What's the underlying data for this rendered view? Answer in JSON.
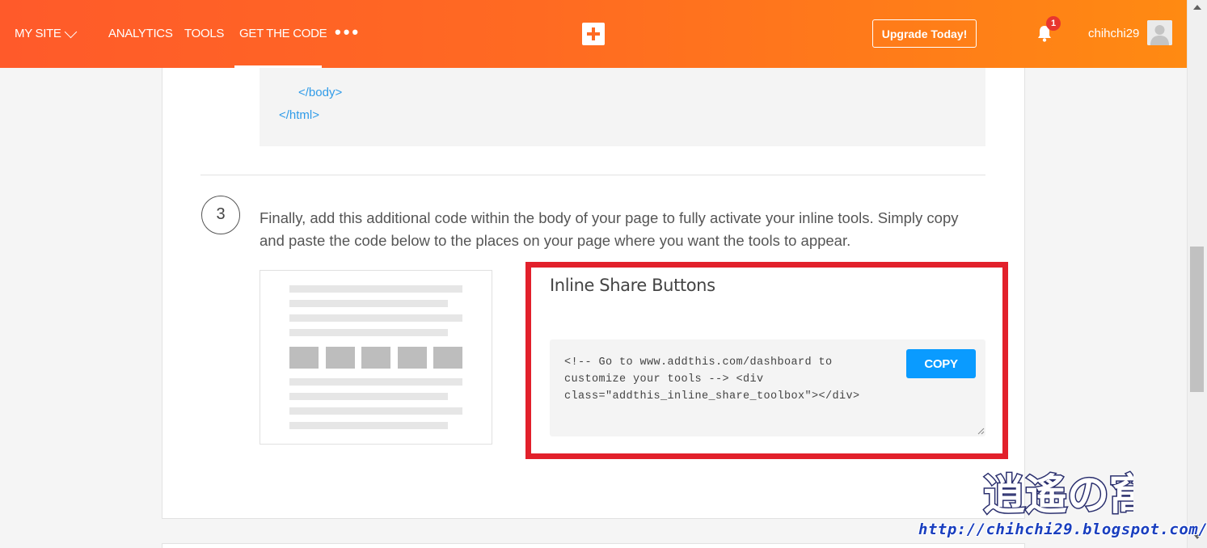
{
  "nav": {
    "my_site": "MY SITE",
    "analytics": "ANALYTICS",
    "tools": "TOOLS",
    "get_the_code": "GET THE CODE",
    "more": "•••",
    "upgrade": "Upgrade Today!",
    "notification_count": "1",
    "username": "chihchi29",
    "brand_color_start": "#ff5a2a",
    "brand_color_end": "#ff8a12"
  },
  "code_preview": {
    "line_body": "</body>",
    "line_html": "</html>"
  },
  "step": {
    "number": "3",
    "text": "Finally, add this additional code within the body of your page to fully activate your inline tools. Simply copy and paste the code below to the places on your page where you want the tools to appear."
  },
  "inline_share": {
    "title": "Inline Share Buttons",
    "code": "<!-- Go to www.addthis.com/dashboard to customize your tools --> <div class=\"addthis_inline_share_toolbox\"></div>",
    "copy_label": "COPY",
    "copy_color": "#0a9bff",
    "highlight_color": "#e2202b"
  },
  "watermark": {
    "logo_text": "逍遙の窩",
    "url": "http://chihchi29.blogspot.com/"
  }
}
